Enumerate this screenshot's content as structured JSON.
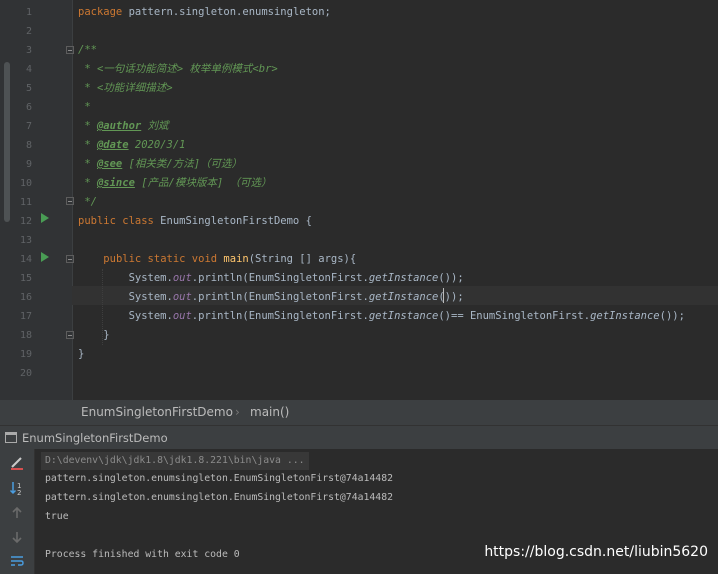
{
  "editor": {
    "line_numbers": [
      "1",
      "2",
      "3",
      "4",
      "5",
      "6",
      "7",
      "8",
      "9",
      "10",
      "11",
      "12",
      "13",
      "14",
      "15",
      "16",
      "17",
      "18",
      "19",
      "20"
    ],
    "lines": {
      "l1_kw": "package",
      "l1_rest": " pattern.singleton.enumsingleton;",
      "l3": "/**",
      "l4": " * <一句话功能简述> 枚举单例模式<br>",
      "l5": " * <功能详细描述>",
      "l6": " *",
      "l7_a": " * ",
      "l7_tag": "@author",
      "l7_b": " 刘斌",
      "l8_a": " * ",
      "l8_tag": "@date",
      "l8_b": " 2020/3/1",
      "l9_a": " * ",
      "l9_tag": "@see",
      "l9_b": " [相关类/方法]（可选）",
      "l10_a": " * ",
      "l10_tag": "@since",
      "l10_b": " [产品/模块版本] （可选）",
      "l11": " */",
      "l12_kw": "public class",
      "l12_rest": " EnumSingletonFirstDemo {",
      "l14_indent": "    ",
      "l14_kw": "public static void",
      "l14_sp": " ",
      "l14_method": "main",
      "l14_rest": "(String [] args){",
      "println_indent": "        System.",
      "println_field": "out",
      "println_call": ".println(EnumSingletonFirst.",
      "println_static": "getInstance",
      "println_end": "());",
      "l17_end": "()== EnumSingletonFirst.",
      "l17_end2": "());",
      "l18": "    }",
      "l19": "}"
    }
  },
  "breadcrumb": {
    "class_name": "EnumSingletonFirstDemo",
    "separator": "›",
    "method_name": "main()"
  },
  "run_panel": {
    "title": "EnumSingletonFirstDemo",
    "console": {
      "command": "D:\\devenv\\jdk\\jdk1.8\\jdk1.8.221\\bin\\java ...",
      "out1": "pattern.singleton.enumsingleton.EnumSingletonFirst@74a14482",
      "out2": "pattern.singleton.enumsingleton.EnumSingletonFirst@74a14482",
      "out3": "true",
      "exit": "Process finished with exit code 0"
    },
    "watermark": "https://blog.csdn.net/liubin5620"
  },
  "colors": {
    "editor_bg": "#2b2b2b",
    "keyword": "#cc7832",
    "comment": "#629755",
    "field": "#9876aa",
    "method": "#ffc66d",
    "text": "#a9b7c6",
    "run_icon": "#499c54"
  },
  "icons": [
    "run-icon",
    "fold-icon",
    "stop-icon",
    "sort-icon",
    "up-arrow-icon",
    "down-arrow-icon",
    "wrap-icon"
  ]
}
